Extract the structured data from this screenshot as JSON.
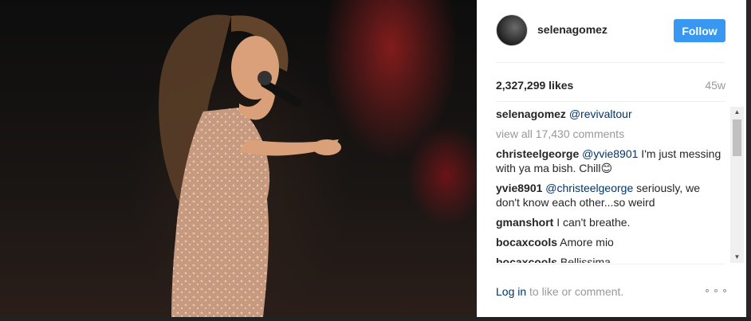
{
  "photo": {
    "alt_name": "concert-photo"
  },
  "header": {
    "username": "selenagomez",
    "follow_label": "Follow"
  },
  "stats": {
    "likes": "2,327,299 likes",
    "time_ago": "45w"
  },
  "caption": {
    "user": "selenagomez",
    "text": "@revivaltour"
  },
  "view_all": "view all 17,430 comments",
  "comments": [
    {
      "user": "christeelgeorge",
      "mention": "@yvie8901",
      "text": " I'm just messing with ya ma bish. Chill😊"
    },
    {
      "user": "yvie8901",
      "mention": "@christeelgeorge",
      "text": " seriously, we don't know each other...so weird"
    },
    {
      "user": "gmanshort",
      "mention": "",
      "text": "I can't breathe."
    },
    {
      "user": "bocaxcools",
      "mention": "",
      "text": "Amore mio"
    },
    {
      "user": "bocaxcools",
      "mention": "",
      "text": "Bellissima"
    }
  ],
  "footer": {
    "login_link": "Log in",
    "login_rest": " to like or comment."
  },
  "colors": {
    "follow_button": "#3897f0",
    "link": "#003569",
    "muted": "#999999"
  },
  "icons": {
    "more": "more-options-icon"
  }
}
